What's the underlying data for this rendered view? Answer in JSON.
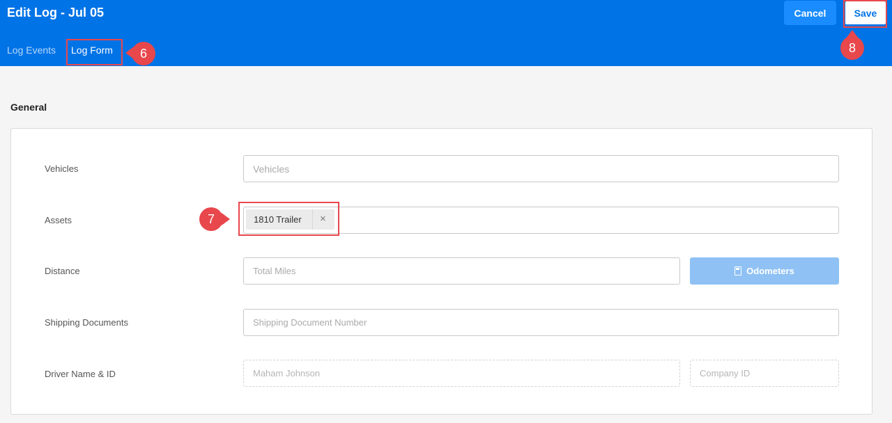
{
  "header": {
    "title": "Edit Log - Jul 05",
    "tabs": [
      {
        "label": "Log Events",
        "active": false
      },
      {
        "label": "Log Form",
        "active": true
      }
    ],
    "cancel_label": "Cancel",
    "save_label": "Save",
    "bar_color": "#0073e6"
  },
  "callouts": {
    "tab": "6",
    "asset": "7",
    "save": "8",
    "color": "#e8474c"
  },
  "form": {
    "section_title": "General",
    "vehicles": {
      "label": "Vehicles",
      "placeholder": "Vehicles"
    },
    "assets": {
      "label": "Assets",
      "chip": "1810 Trailer",
      "remove_glyph": "×"
    },
    "distance": {
      "label": "Distance",
      "placeholder": "Total Miles",
      "odometers_label": "Odometers",
      "odometers_icon": "calculator-icon"
    },
    "shipping": {
      "label": "Shipping Documents",
      "placeholder": "Shipping Document Number"
    },
    "driver": {
      "label": "Driver Name & ID",
      "name_value": "Maham Johnson",
      "company_placeholder": "Company ID"
    }
  }
}
